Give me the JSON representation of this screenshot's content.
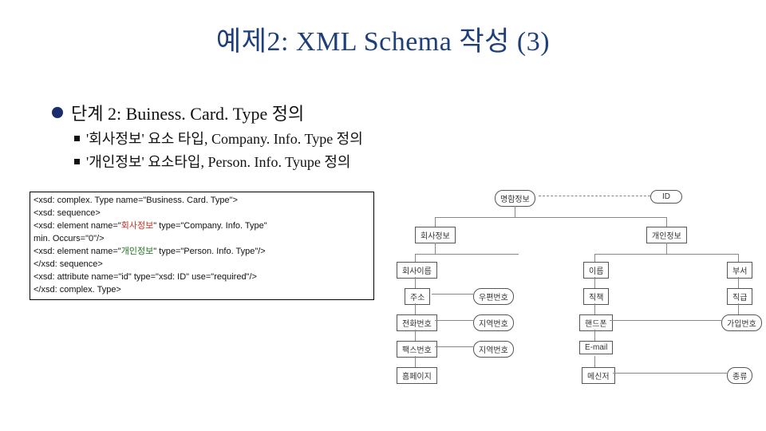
{
  "title": "예제2: XML Schema 작성 (3)",
  "heading": "단계 2: Buiness. Card. Type 정의",
  "sub1": "'회사정보' 요소 타입, Company. Info. Type 정의",
  "sub2": "'개인정보' 요소타입, Person. Info. Tyupe 정의",
  "code": {
    "l1": "<xsd: complex. Type name=\"Business. Card. Type\">",
    "l2": " <xsd: sequence>",
    "l3a": "  <xsd: element name=\"",
    "l3b": "회사정보",
    "l3c": "\" type=\"Company. Info. Type\"",
    "l4": "min. Occurs=\"0\"/>",
    "l5a": "  <xsd: element name=\"",
    "l5b": "개인정보",
    "l5c": "\" type=\"Person. Info. Type\"/>",
    "l6": " </xsd: sequence>",
    "l7": " <xsd: attribute name=\"id\" type=\"xsd: ID\" use=\"required\"/>",
    "l8": "</xsd: complex. Type>"
  },
  "diagram": {
    "root": "명함정보",
    "id": "ID",
    "company": "회사정보",
    "person": "개인정보",
    "c_name": "회사이름",
    "c_addr": "주소",
    "c_zip": "우편번호",
    "c_tel": "전화번호",
    "c_area": "지역번호",
    "c_fax": "팩스번호",
    "c_area2": "지역번호",
    "c_home": "홈페이지",
    "p_name": "이름",
    "p_dept": "부서",
    "p_rank": "직책",
    "p_title": "직급",
    "p_mobile": "핸드폰",
    "p_join": "가입번호",
    "p_email": "E-mail",
    "p_msg": "메신저",
    "p_kind": "종류"
  }
}
